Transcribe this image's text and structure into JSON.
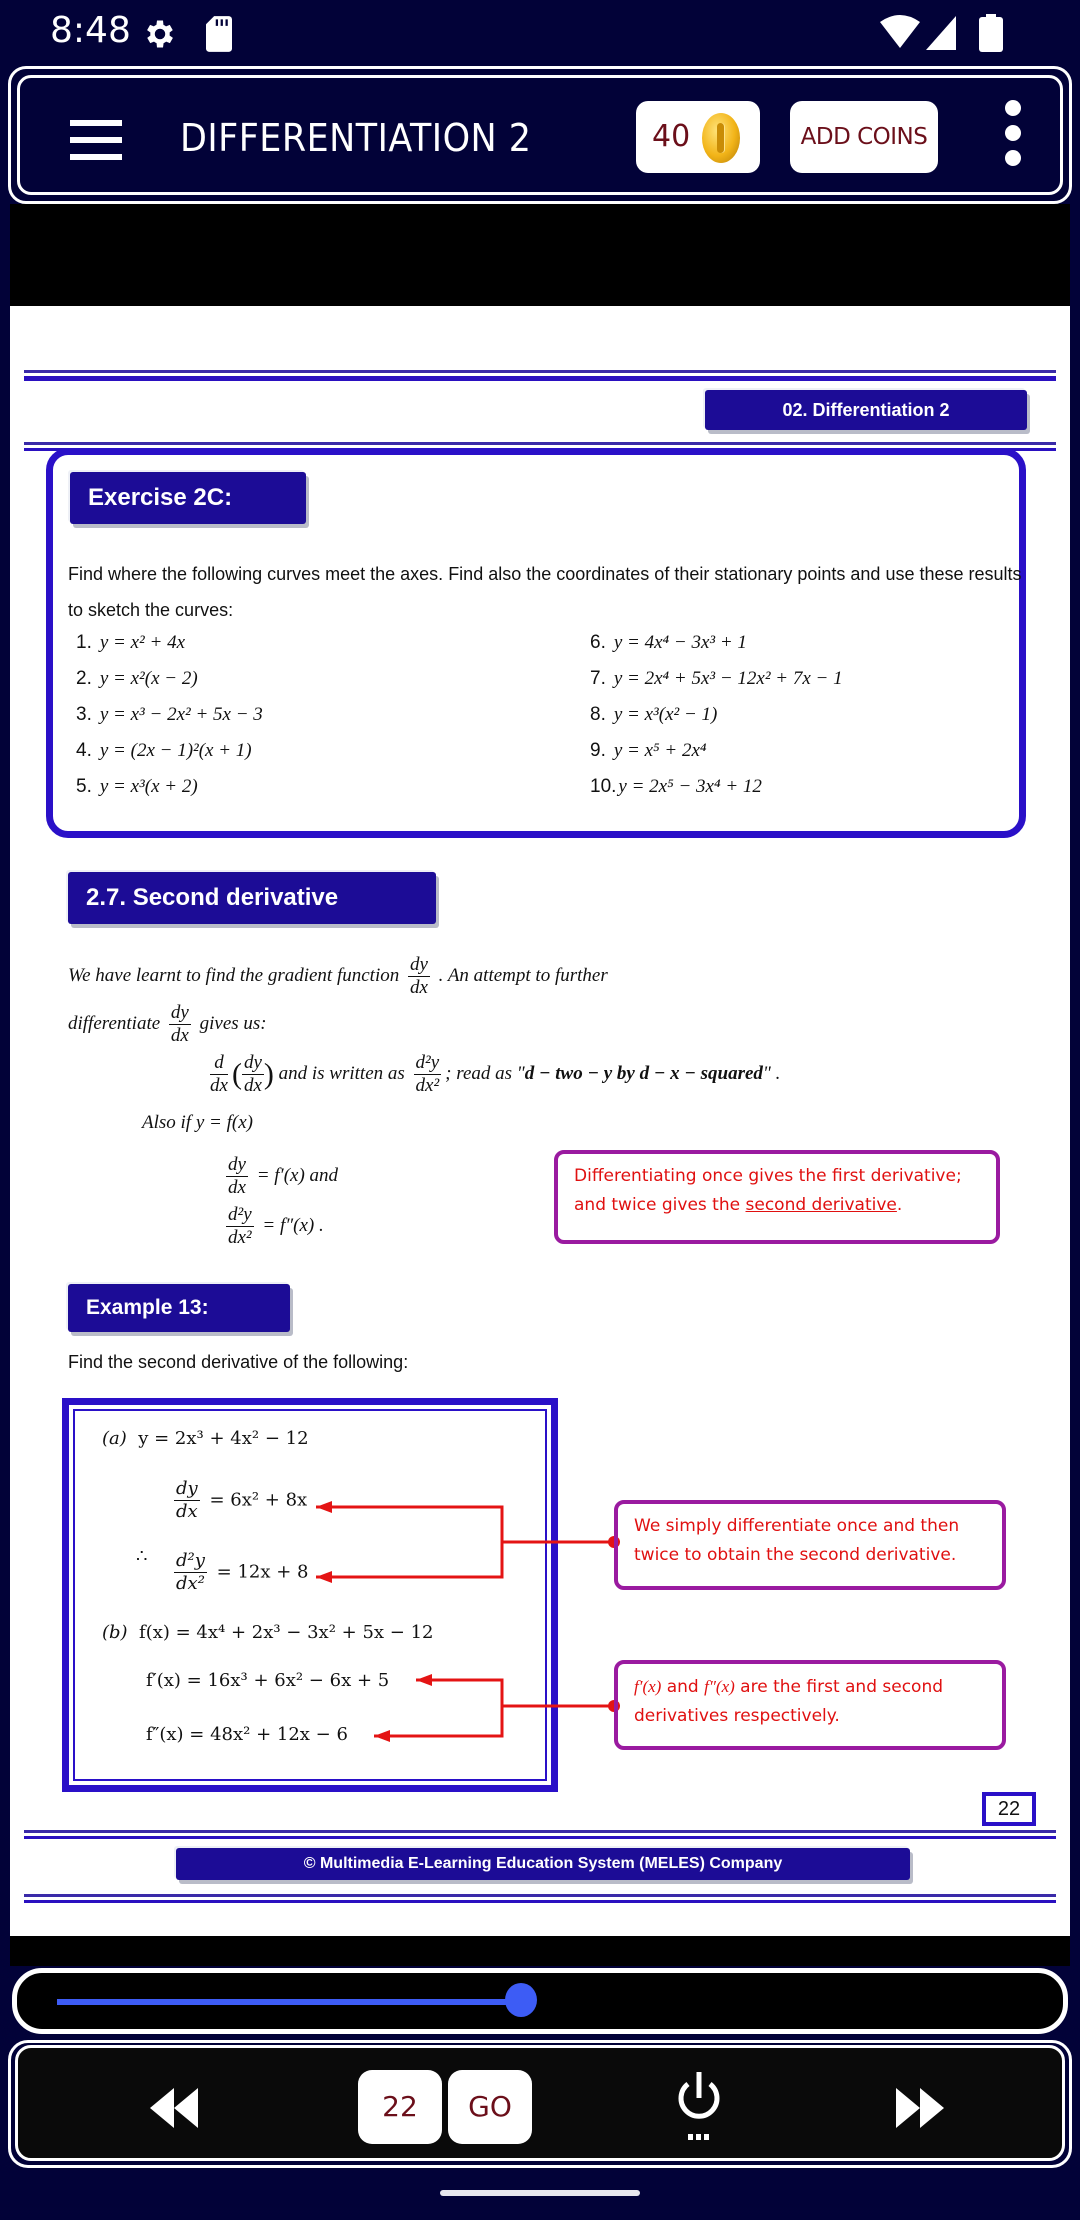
{
  "status_bar": {
    "time": "8:48",
    "icons_left": [
      "settings-gear-icon",
      "sd-card-icon"
    ],
    "icons_right": [
      "wifi-icon",
      "cellular-signal-icon",
      "battery-icon"
    ]
  },
  "header": {
    "title": "DIFFERENTIATION 2",
    "coins": "40",
    "add_coins_label": "ADD COINS",
    "colors": {
      "bar_bg": "#020238",
      "button_text": "#6b0f1a"
    }
  },
  "page": {
    "chapter_label": "02. Differentiation 2",
    "exercise": {
      "title": "Exercise 2C:",
      "intro": "Find where the following curves meet the axes. Find also the coordinates of their stationary points and use these results to sketch the curves:",
      "items": [
        {
          "num": "1.",
          "eq": "y = x² + 4x"
        },
        {
          "num": "2.",
          "eq": "y = x²(x − 2)"
        },
        {
          "num": "3.",
          "eq": "y = x³ − 2x² + 5x − 3"
        },
        {
          "num": "4.",
          "eq": "y = (2x − 1)²(x + 1)"
        },
        {
          "num": "5.",
          "eq": "y = x³(x + 2)"
        },
        {
          "num": "6.",
          "eq": "y = 4x⁴ − 3x³ + 1"
        },
        {
          "num": "7.",
          "eq": "y = 2x⁴ + 5x³ − 12x² + 7x − 1"
        },
        {
          "num": "8.",
          "eq": "y = x³(x² − 1)"
        },
        {
          "num": "9.",
          "eq": "y = x⁵ + 2x⁴"
        },
        {
          "num": "10.",
          "eq": "y = 2x⁵ − 3x⁴ + 12"
        }
      ]
    },
    "section": {
      "title": "2.7. Second derivative",
      "line1_a": "We have learnt to find the gradient function",
      "line1_b": ".  An attempt to further",
      "line2_a": "differentiate",
      "line2_b": "gives us:",
      "line3_a": "and is written as",
      "line3_b": "; read as \"",
      "line3_bold": "d − two − y  by  d − x − squared",
      "line3_c": "\" .",
      "frac_d": "d",
      "frac_dy": "dy",
      "frac_dx": "dx",
      "frac_d2y": "d²y",
      "frac_dx2": "dx²",
      "also_if": "Also if   y   =   f(x)",
      "eq_first": "=  f′(x)    and",
      "eq_second": "=  f″(x) .",
      "note": {
        "text_a": "Differentiating once gives the first derivative; and twice gives the ",
        "underlined": "second derivative",
        "text_b": "."
      }
    },
    "example": {
      "title": "Example 13:",
      "intro": "Find the second derivative of the following:",
      "part_a": {
        "label": "(a)",
        "eq": "y = 2x³ +  4x² − 12",
        "first": "= 6x² +  8x",
        "therefore": "∴",
        "second": "= 12x + 8"
      },
      "part_b": {
        "label": "(b)",
        "eq": "f(x)  =   4x⁴ +  2x³ − 3x² + 5x − 12",
        "first": "f′(x)  =  16x³ +  6x² − 6x + 5",
        "second": "f″(x) =  48x²  + 12x − 6"
      },
      "note_a": "We simply differentiate once and then twice to obtain the second derivative.",
      "note_b_f1": "f′(x)",
      "note_b_and": " and ",
      "note_b_f2": "f″(x)",
      "note_b_rest": " are the first and second derivatives respectively."
    },
    "page_number": "22",
    "copyright": "© Multimedia E-Learning Education System (MELES) Company",
    "colors": {
      "accent": "#2a10c8",
      "chip_bg": "#1c0c96",
      "note_border": "#9a1aa0",
      "note_text": "#e01010"
    }
  },
  "slider": {
    "progress_fraction": 0.48,
    "color": "#3d5cf5"
  },
  "nav": {
    "page_input_value": "22",
    "go_label": "GO"
  }
}
